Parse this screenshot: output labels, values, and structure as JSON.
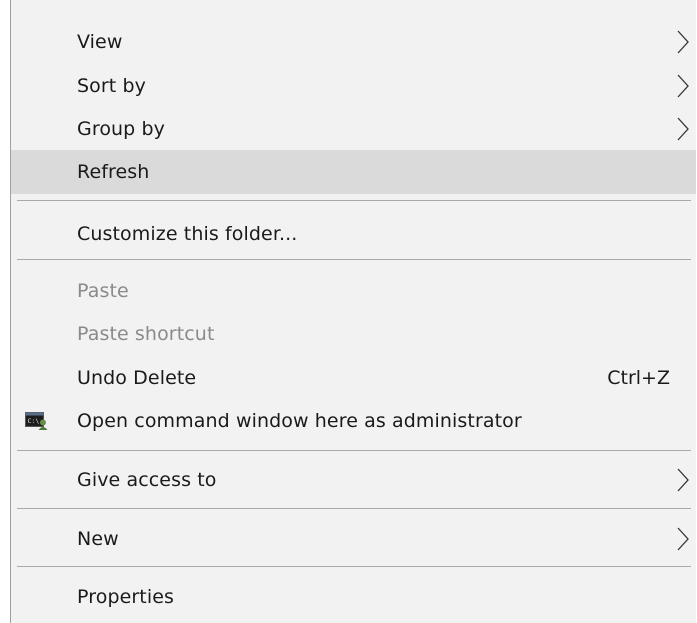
{
  "menu": {
    "view": "View",
    "sort_by": "Sort by",
    "group_by": "Group by",
    "refresh": "Refresh",
    "customize": "Customize this folder...",
    "paste": "Paste",
    "paste_shortcut": "Paste shortcut",
    "undo_delete": "Undo Delete",
    "undo_delete_shortcut": "Ctrl+Z",
    "open_cmd_admin": "Open command window here as administrator",
    "give_access": "Give access to",
    "new": "New",
    "properties": "Properties"
  },
  "icons": {
    "submenu": "chevron-right-icon",
    "cmd": "command-prompt-admin-icon"
  },
  "colors": {
    "menu_bg": "#f2f2f2",
    "hover_bg": "#dadada",
    "separator": "#a9a9a9",
    "disabled_text": "#8a8a8a"
  }
}
